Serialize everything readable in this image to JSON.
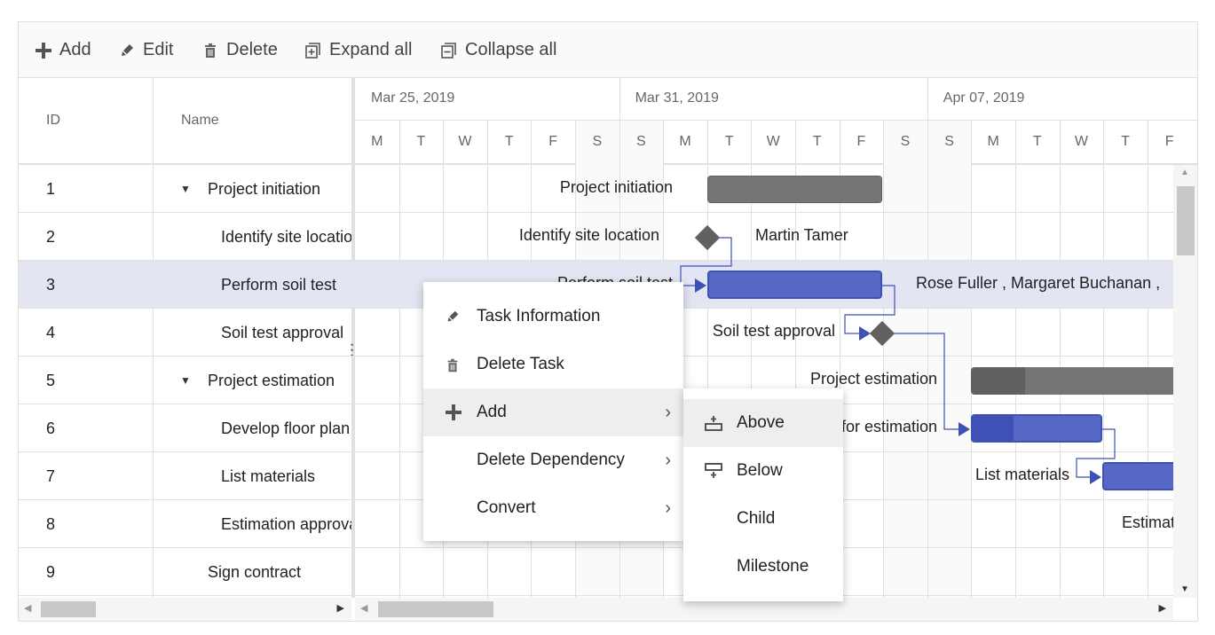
{
  "toolbar": {
    "add": "Add",
    "edit": "Edit",
    "delete": "Delete",
    "expand_all": "Expand all",
    "collapse_all": "Collapse all"
  },
  "grid": {
    "columns": {
      "id": "ID",
      "name": "Name"
    },
    "rows": [
      {
        "id": "1",
        "name": "Project initiation",
        "parent": true
      },
      {
        "id": "2",
        "name": "Identify site location"
      },
      {
        "id": "3",
        "name": "Perform soil test",
        "selected": true
      },
      {
        "id": "4",
        "name": "Soil test approval"
      },
      {
        "id": "5",
        "name": "Project estimation",
        "parent": true
      },
      {
        "id": "6",
        "name": "Develop floor plan for estimation"
      },
      {
        "id": "7",
        "name": "List materials"
      },
      {
        "id": "8",
        "name": "Estimation approval"
      },
      {
        "id": "9",
        "name": "Sign contract"
      }
    ]
  },
  "timeline": {
    "weeks": [
      "Mar 25, 2019",
      "Mar 31, 2019",
      "Apr 07, 2019"
    ],
    "days": [
      "M",
      "T",
      "W",
      "T",
      "F",
      "S",
      "S",
      "M",
      "T",
      "W",
      "T",
      "F",
      "S",
      "S",
      "M",
      "T",
      "W",
      "T",
      "F"
    ]
  },
  "chart": {
    "labels": {
      "r1": "Project initiation",
      "r2": "Identify site location",
      "r2_res": "Martin Tamer",
      "r3": "Perform soil test",
      "r3_res": "Rose Fuller , Margaret Buchanan ,",
      "r4": "Soil test approval",
      "r5": "Project estimation",
      "r6": "Develop floor plan for estimation",
      "r7": "List materials",
      "r8": "Estimation approval"
    },
    "colors": {
      "parent": "#757575",
      "parent_progress": "#616161",
      "task": "#5767c6",
      "task_progress": "#3f51b5",
      "milestone": "#616161",
      "connector": "#3f51b5",
      "selected_row": "#e3e5f3"
    }
  },
  "context_menu": {
    "items": [
      "Task Information",
      "Delete Task",
      "Add",
      "Delete Dependency",
      "Convert"
    ],
    "submenu": [
      "Above",
      "Below",
      "Child",
      "Milestone"
    ]
  }
}
